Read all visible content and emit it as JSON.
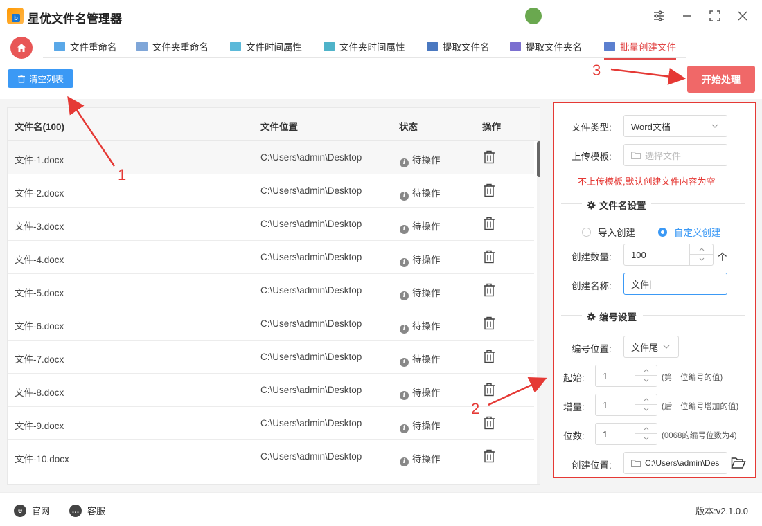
{
  "app": {
    "title": "星优文件名管理器",
    "logo_letter": "b"
  },
  "tabs": [
    {
      "label": "文件重命名",
      "color": "#5aa8e8"
    },
    {
      "label": "文件夹重命名",
      "color": "#7fa6d8"
    },
    {
      "label": "文件时间属性",
      "color": "#5bb9d9"
    },
    {
      "label": "文件夹时间属性",
      "color": "#4fb3c9"
    },
    {
      "label": "提取文件名",
      "color": "#4a78c0"
    },
    {
      "label": "提取文件夹名",
      "color": "#7b6fd0"
    },
    {
      "label": "批量创建文件",
      "color": "#5b7fcf",
      "active": true
    }
  ],
  "toolbar": {
    "clear_label": "清空列表",
    "start_label": "开始处理"
  },
  "table": {
    "headers": {
      "name": "文件名(100)",
      "location": "文件位置",
      "status": "状态",
      "action": "操作"
    },
    "rows": [
      {
        "name": "文件-1.docx",
        "location": "C:\\Users\\admin\\Desktop",
        "status": "待操作"
      },
      {
        "name": "文件-2.docx",
        "location": "C:\\Users\\admin\\Desktop",
        "status": "待操作"
      },
      {
        "name": "文件-3.docx",
        "location": "C:\\Users\\admin\\Desktop",
        "status": "待操作"
      },
      {
        "name": "文件-4.docx",
        "location": "C:\\Users\\admin\\Desktop",
        "status": "待操作"
      },
      {
        "name": "文件-5.docx",
        "location": "C:\\Users\\admin\\Desktop",
        "status": "待操作"
      },
      {
        "name": "文件-6.docx",
        "location": "C:\\Users\\admin\\Desktop",
        "status": "待操作"
      },
      {
        "name": "文件-7.docx",
        "location": "C:\\Users\\admin\\Desktop",
        "status": "待操作"
      },
      {
        "name": "文件-8.docx",
        "location": "C:\\Users\\admin\\Desktop",
        "status": "待操作"
      },
      {
        "name": "文件-9.docx",
        "location": "C:\\Users\\admin\\Desktop",
        "status": "待操作"
      },
      {
        "name": "文件-10.docx",
        "location": "C:\\Users\\admin\\Desktop",
        "status": "待操作"
      }
    ]
  },
  "settings": {
    "file_type_label": "文件类型:",
    "file_type_value": "Word文档",
    "upload_label": "上传模板:",
    "upload_placeholder": "选择文件",
    "upload_hint": "不上传模板,默认创建文件内容为空",
    "filename_section": "文件名设置",
    "radio_import": "导入创建",
    "radio_custom": "自定义创建",
    "count_label": "创建数量:",
    "count_value": "100",
    "count_unit": "个",
    "name_label": "创建名称:",
    "name_value": "文件",
    "numbering_section": "编号设置",
    "position_label": "编号位置:",
    "position_value": "文件尾",
    "start_label": "起始:",
    "start_value": "1",
    "start_note": "(第一位编号的值)",
    "step_label": "增量:",
    "step_value": "1",
    "step_note": "(后一位编号增加的值)",
    "digits_label": "位数:",
    "digits_value": "1",
    "digits_note": "(0068的编号位数为4)",
    "location_label": "创建位置:",
    "location_value": "C:\\Users\\admin\\Des"
  },
  "annotations": {
    "one": "1",
    "two": "2",
    "three": "3"
  },
  "footer": {
    "website": "官网",
    "support": "客服",
    "version": "版本:v2.1.0.0"
  },
  "colors": {
    "accent": "#3b99f5",
    "danger": "#e53935",
    "start_button": "#f06868"
  }
}
